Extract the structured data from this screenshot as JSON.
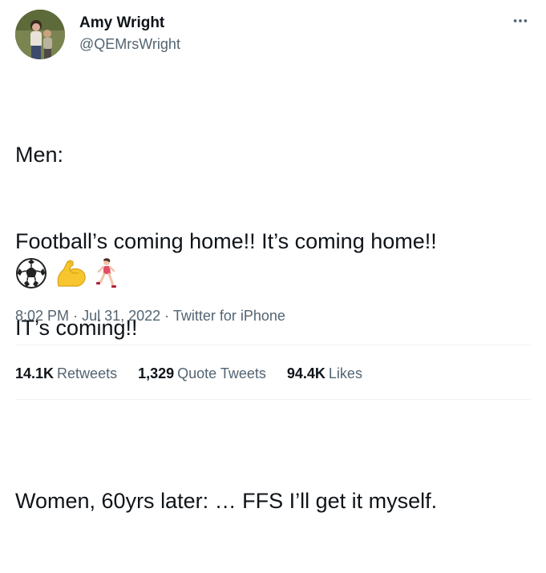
{
  "author": {
    "name": "Amy Wright",
    "handle": "@QEMrsWright"
  },
  "tweet": {
    "lines": [
      "Men:",
      "Football’s coming home!! It’s coming home!!",
      "IT’s coming!!",
      "",
      "Women, 60yrs later: … FFS I’ll get it myself."
    ],
    "emojis": [
      "soccer-ball-icon",
      "flexed-biceps-icon",
      "woman-running-icon"
    ]
  },
  "meta": {
    "time": "8:02 PM",
    "separator": "·",
    "date": "Jul 31, 2022",
    "source": "Twitter for iPhone"
  },
  "stats": {
    "retweets_count": "14.1K",
    "retweets_label": "Retweets",
    "quotes_count": "1,329",
    "quotes_label": "Quote Tweets",
    "likes_count": "94.4K",
    "likes_label": "Likes"
  },
  "colors": {
    "text_primary": "#0f1419",
    "text_secondary": "#536471",
    "divider": "#eff3f4"
  }
}
